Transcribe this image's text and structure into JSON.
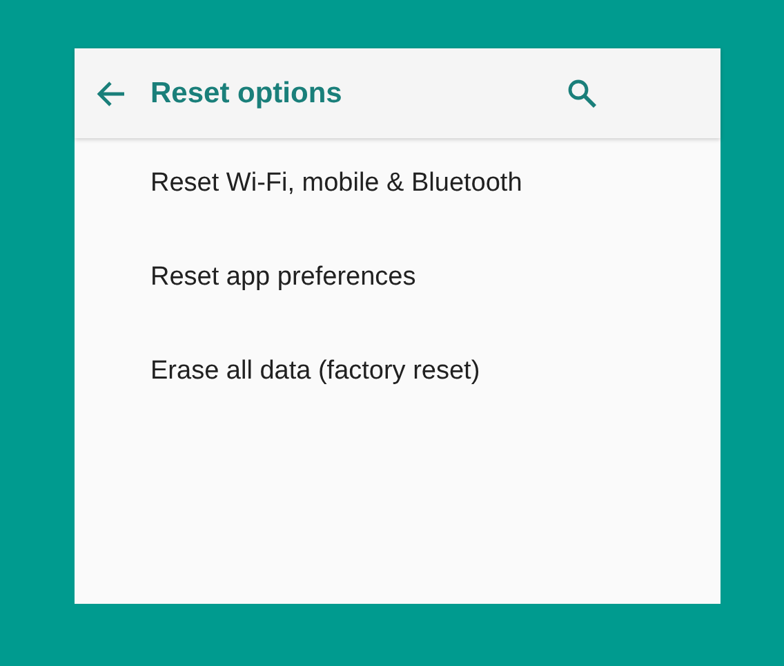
{
  "app_bar": {
    "title": "Reset options"
  },
  "items": [
    {
      "label": "Reset Wi-Fi, mobile & Bluetooth"
    },
    {
      "label": "Reset app preferences"
    },
    {
      "label": "Erase all data (factory reset)"
    }
  ]
}
